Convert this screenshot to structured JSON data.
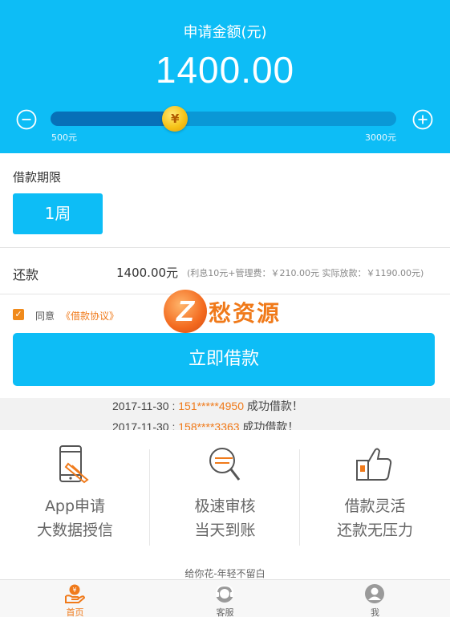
{
  "header": {
    "title": "申请金额(元)",
    "amount": "1400.00",
    "slider": {
      "min_label": "500元",
      "max_label": "3000元",
      "min_value": 500,
      "max_value": 3000,
      "value": 1400,
      "knob_symbol": "¥"
    }
  },
  "period": {
    "label": "借款期限",
    "selected": "1周"
  },
  "repay": {
    "label": "还款",
    "value": "1400.00元",
    "detail": "(利息10元+管理费：￥210.00元 实际放款：￥1190.00元)"
  },
  "agree": {
    "text": "同意",
    "link": "《借款协议》"
  },
  "watermark": {
    "logo_letter": "Z",
    "text": "愁资源"
  },
  "apply_button": "立即借款",
  "ticker": [
    {
      "date": "2017-11-30 : ",
      "phone": "151*****4950",
      "status": " 成功借款！"
    },
    {
      "date": "2017-11-30 : ",
      "phone": "158****3363",
      "status": " 成功借款！"
    }
  ],
  "features": [
    {
      "icon": "phone-apply-icon",
      "line1": "App申请",
      "line2": "大数据授信"
    },
    {
      "icon": "search-review-icon",
      "line1": "极速审核",
      "line2": "当天到账"
    },
    {
      "icon": "thumbs-up-icon",
      "line1": "借款灵活",
      "line2": "还款无压力"
    }
  ],
  "slogan": "给你花-年轻不留白",
  "tabbar": [
    {
      "icon": "home-icon",
      "label": "首页",
      "active": true
    },
    {
      "icon": "service-icon",
      "label": "客服",
      "active": false
    },
    {
      "icon": "user-icon",
      "label": "我",
      "active": false
    }
  ],
  "colors": {
    "primary": "#0dbdf6",
    "accent": "#f07a1a",
    "slider_fill": "#0770b8",
    "knob": "#f6c318"
  }
}
